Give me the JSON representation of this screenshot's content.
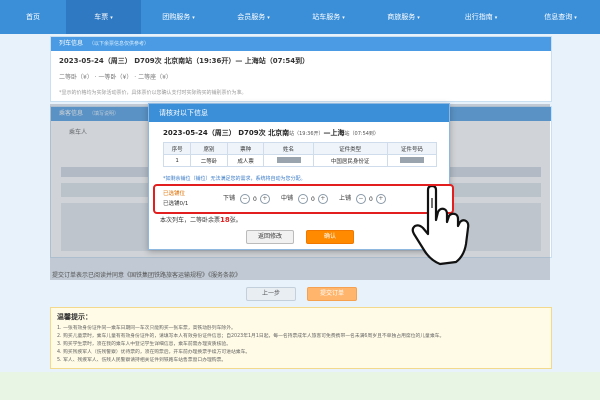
{
  "nav": {
    "items": [
      {
        "label": "首页",
        "caret": ""
      },
      {
        "label": "车票",
        "caret": "▾"
      },
      {
        "label": "团购服务",
        "caret": "▾"
      },
      {
        "label": "会员服务",
        "caret": "▾"
      },
      {
        "label": "站车服务",
        "caret": "▾"
      },
      {
        "label": "商旅服务",
        "caret": "▾"
      },
      {
        "label": "出行指南",
        "caret": "▾"
      },
      {
        "label": "信息查询",
        "caret": "▾"
      }
    ]
  },
  "train_panel": {
    "title": "列车信息",
    "note": "（以下余票信息仅供参考）",
    "trip_line": "2023-05-24（周三） D709次 北京南站（19:36开）— 上海站（07:54到）",
    "seats_line": "二等卧（¥）  ·  一等卧（¥）  ·  二等座（¥）",
    "hint": "*显示的价格均为实际活动票价，具体票价以您确认支付时实际购买的铺别票价为准。"
  },
  "passenger_panel": {
    "title": "乘客信息",
    "note": "（填写说明）",
    "sub": "乘车人"
  },
  "modal": {
    "title": "请核对以下信息",
    "trip_date": "2023-05-24（周三）",
    "train_no": "D709次",
    "from": "北京南",
    "from_suffix": "站（19:36开）",
    "arrow": "—",
    "to": "上海",
    "to_suffix": "站（07:54到）",
    "table_headers": [
      "序号",
      "席别",
      "票种",
      "姓名",
      "证件类型",
      "证件号码"
    ],
    "row": {
      "no": "1",
      "seat": "二等卧",
      "ticket_type": "成人票",
      "id_type": "中国居民身份证"
    },
    "tip": "*如剩余铺位（铺位）无法满足您的需求，系统将自动为您分配。"
  },
  "seat_select": {
    "title": "已选铺位",
    "subtitle": "已选铺0/1",
    "berths": [
      {
        "label": "下铺",
        "minus": "−",
        "count": "0",
        "plus": "+"
      },
      {
        "label": "中铺",
        "minus": "−",
        "count": "0",
        "plus": "+"
      },
      {
        "label": "上铺",
        "minus": "−",
        "count": "0",
        "plus": "+"
      }
    ]
  },
  "left_count": {
    "prefix": "本次列车，二等卧余票",
    "number": "18",
    "suffix": "张。"
  },
  "buttons": {
    "back": "返回修改",
    "confirm": "确认"
  },
  "page_buttons": {
    "prev": "上一步",
    "submit": "提交订单"
  },
  "agreement": "提交订单表示已阅读并同意《国铁集团铁路旅客运输规程》《服务条款》",
  "warm_tips": {
    "title": "温馨提示：",
    "lines": [
      "1. 一张有效身份证件同一乘车日期同一车次只能购买一张车票，高铁动卧列车除外。",
      "2. 购买儿童票时，乘车儿童有有效身份证件的，请填写本人有效身份证件信息；自2023年1月1日起，每一名持票成年人旅客可免费携带一名未满6周岁且不单独占用席位的儿童乘车。",
      "3. 购买学生票时，须在我的乘车人中登记学生详细信息，乘车前需办理资质核验。",
      "4. 购买残疾军人（伤残警察）优待票的，须在购票后，开车前办理换票手续方可进站乘车。",
      "5. 军人、残疾军人、伤残人民警察请持相关证件到铁路车站售票窗口办理购票。"
    ]
  },
  "colors": {
    "nav": "#3b8fd9",
    "accent": "#ff8a00",
    "highlight": "#e21e1e"
  }
}
